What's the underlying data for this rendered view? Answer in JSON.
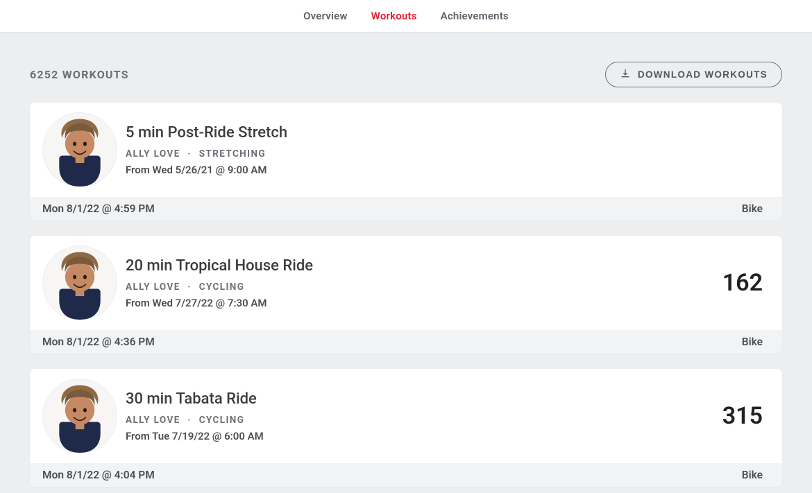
{
  "tabs": [
    {
      "label": "Overview",
      "active": false
    },
    {
      "label": "Workouts",
      "active": true
    },
    {
      "label": "Achievements",
      "active": false
    }
  ],
  "header": {
    "count_text": "6252 WORKOUTS",
    "download_label": "DOWNLOAD WORKOUTS"
  },
  "workouts": [
    {
      "title": "5 min Post-Ride Stretch",
      "instructor": "ALLY LOVE",
      "category": "STRETCHING",
      "from": "From Wed 5/26/21 @ 9:00 AM",
      "metric": "",
      "footer_time": "Mon 8/1/22 @ 4:59 PM",
      "footer_device": "Bike"
    },
    {
      "title": "20 min Tropical House Ride",
      "instructor": "ALLY LOVE",
      "category": "CYCLING",
      "from": "From Wed 7/27/22 @ 7:30 AM",
      "metric": "162",
      "footer_time": "Mon 8/1/22 @ 4:36 PM",
      "footer_device": "Bike"
    },
    {
      "title": "30 min Tabata Ride",
      "instructor": "ALLY LOVE",
      "category": "CYCLING",
      "from": "From Tue 7/19/22 @ 6:00 AM",
      "metric": "315",
      "footer_time": "Mon 8/1/22 @ 4:04 PM",
      "footer_device": "Bike"
    }
  ]
}
